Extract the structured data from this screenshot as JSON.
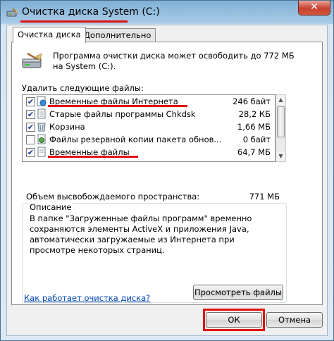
{
  "window": {
    "title": "Очистка диска System (C:)",
    "close_label": "✕"
  },
  "tabs": [
    {
      "label": "Очистка диска",
      "active": true
    },
    {
      "label": "Дополнительно",
      "active": false
    }
  ],
  "summary_text": "Программа очистки диска может освободить до 772 МБ на System (C:).",
  "files_label": "Удалить следующие файлы:",
  "files": [
    {
      "checked": true,
      "icon": "internet-files-icon",
      "name": "Временные файлы Интернета",
      "size": "246 байт"
    },
    {
      "checked": true,
      "icon": "chkdsk-files-icon",
      "name": "Старые файлы программы Chkdsk",
      "size": "28,2 КБ"
    },
    {
      "checked": true,
      "icon": "recycle-bin-icon",
      "name": "Корзина",
      "size": "1,66 МБ"
    },
    {
      "checked": false,
      "icon": "backup-files-icon",
      "name": "Файлы резервной копии пакета обнов...",
      "size": "0 байт"
    },
    {
      "checked": true,
      "icon": "temp-files-icon",
      "name": "Временные файлы",
      "size": "64,7 МБ"
    }
  ],
  "free_space": {
    "label": "Объем высвобождаемого пространства:",
    "value": "771 МБ"
  },
  "description": {
    "title": "Описание",
    "text": "В папке \"Загруженные файлы программ\" временно сохраняются элементы ActiveX и приложения Java, автоматически загружаемые из Интернета при просмотре некоторых страниц."
  },
  "view_files_button": "Просмотреть файлы",
  "help_link": "Как работает очистка диска?",
  "ok_button": "ОК",
  "cancel_button": "Отмена",
  "colors": {
    "highlight_red": "#e01010",
    "link_blue": "#0045b5"
  }
}
